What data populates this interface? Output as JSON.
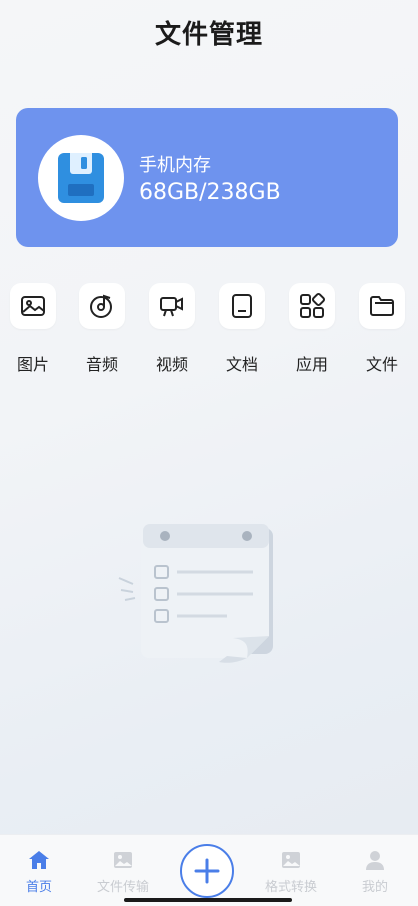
{
  "header": {
    "title": "文件管理"
  },
  "storage": {
    "label": "手机内存",
    "value": "68GB/238GB",
    "icon": "floppy-disk-icon",
    "card_color": "#6e93ee"
  },
  "categories": [
    {
      "label": "图片",
      "icon": "image-icon"
    },
    {
      "label": "音频",
      "icon": "music-disc-icon"
    },
    {
      "label": "视频",
      "icon": "video-camera-icon"
    },
    {
      "label": "文档",
      "icon": "document-icon"
    },
    {
      "label": "应用",
      "icon": "apps-grid-icon"
    },
    {
      "label": "文件",
      "icon": "folder-icon"
    }
  ],
  "empty_state": {
    "icon": "empty-clipboard-illustration"
  },
  "tabbar": {
    "accent": "#4a7ee8",
    "items": [
      {
        "label": "首页",
        "icon": "home-icon",
        "active": true
      },
      {
        "label": "文件传输",
        "icon": "image-icon",
        "active": false
      },
      {
        "label": "",
        "icon": "plus-icon",
        "active": false
      },
      {
        "label": "格式转换",
        "icon": "image-icon",
        "active": false
      },
      {
        "label": "我的",
        "icon": "person-icon",
        "active": false
      }
    ]
  }
}
